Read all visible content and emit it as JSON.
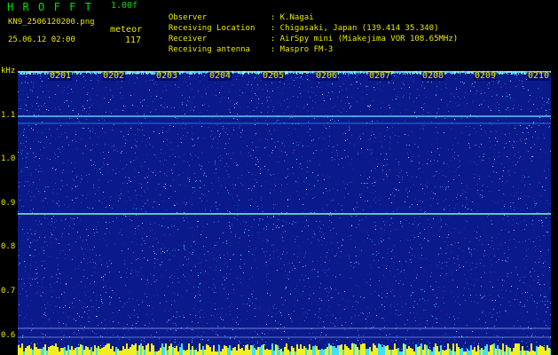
{
  "header": {
    "app_title": "HROFFT",
    "app_version": "1.00f",
    "file_name": "KN9_2506120200.png",
    "mode": "meteor",
    "datetime": "25.06.12 02:00",
    "count": "117"
  },
  "info": [
    {
      "key": "Observer",
      "value": ": K.Nagai"
    },
    {
      "key": "Receiving Location",
      "value": ": Chigasaki, Japan (139.414 35.340)"
    },
    {
      "key": "Receiver",
      "value": ": AirSpy mini (Miakejima VOR 108.65MHz)"
    },
    {
      "key": "Receiving antenna",
      "value": ": Maspro FM-3"
    }
  ],
  "axis": {
    "unit": "kHz",
    "y_ticks": [
      "1.1",
      "1.0",
      "0.9",
      "0.8",
      "0.7",
      "0.6"
    ],
    "x_ticks": [
      "0201",
      "0202",
      "0203",
      "0204",
      "0205",
      "0206",
      "0207",
      "0208",
      "0209",
      "0210"
    ]
  },
  "colors": {
    "background": "#000000",
    "label_yellow": "#e8e800",
    "title_green": "#00e000",
    "plot_base": "#0a1a8a"
  }
}
